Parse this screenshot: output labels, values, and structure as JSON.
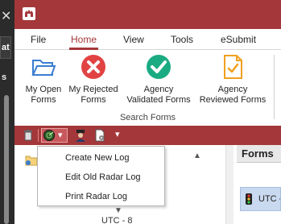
{
  "left_strip": {
    "close_glyph": "✕",
    "partial_text": "at",
    "partial_text_2": "s"
  },
  "tabs": [
    {
      "label": "File"
    },
    {
      "label": "Home"
    },
    {
      "label": "View"
    },
    {
      "label": "Tools"
    },
    {
      "label": "eSubmit"
    }
  ],
  "ribbon": {
    "buttons": [
      {
        "line1": "My Open",
        "line2": "Forms",
        "icon": "folder-open-icon"
      },
      {
        "line1": "My Rejected",
        "line2": "Forms",
        "icon": "rejected-x-icon"
      },
      {
        "line1": "Agency",
        "line2": "Validated Forms",
        "icon": "validated-check-icon"
      },
      {
        "line1": "Agency",
        "line2": "Reviewed Forms",
        "icon": "reviewed-document-icon"
      }
    ],
    "group_label": "Search Forms"
  },
  "toolbar": {
    "dropdown_glyph": "▾"
  },
  "menu": {
    "items": [
      {
        "label": "Create New Log"
      },
      {
        "label": "Edit Old Radar Log"
      },
      {
        "label": "Print Radar Log"
      }
    ]
  },
  "left_pane": {
    "up_glyph": "▲",
    "down_glyph": "▼",
    "utc_label": "UTC - 8"
  },
  "right_pane": {
    "header": "Forms",
    "row_text": "UTC -"
  },
  "colors": {
    "accent": "#a4373a",
    "rejected": "#e14343",
    "validated": "#1bab83",
    "folder": "#3b7ed0",
    "reviewed": "#f0a020"
  }
}
